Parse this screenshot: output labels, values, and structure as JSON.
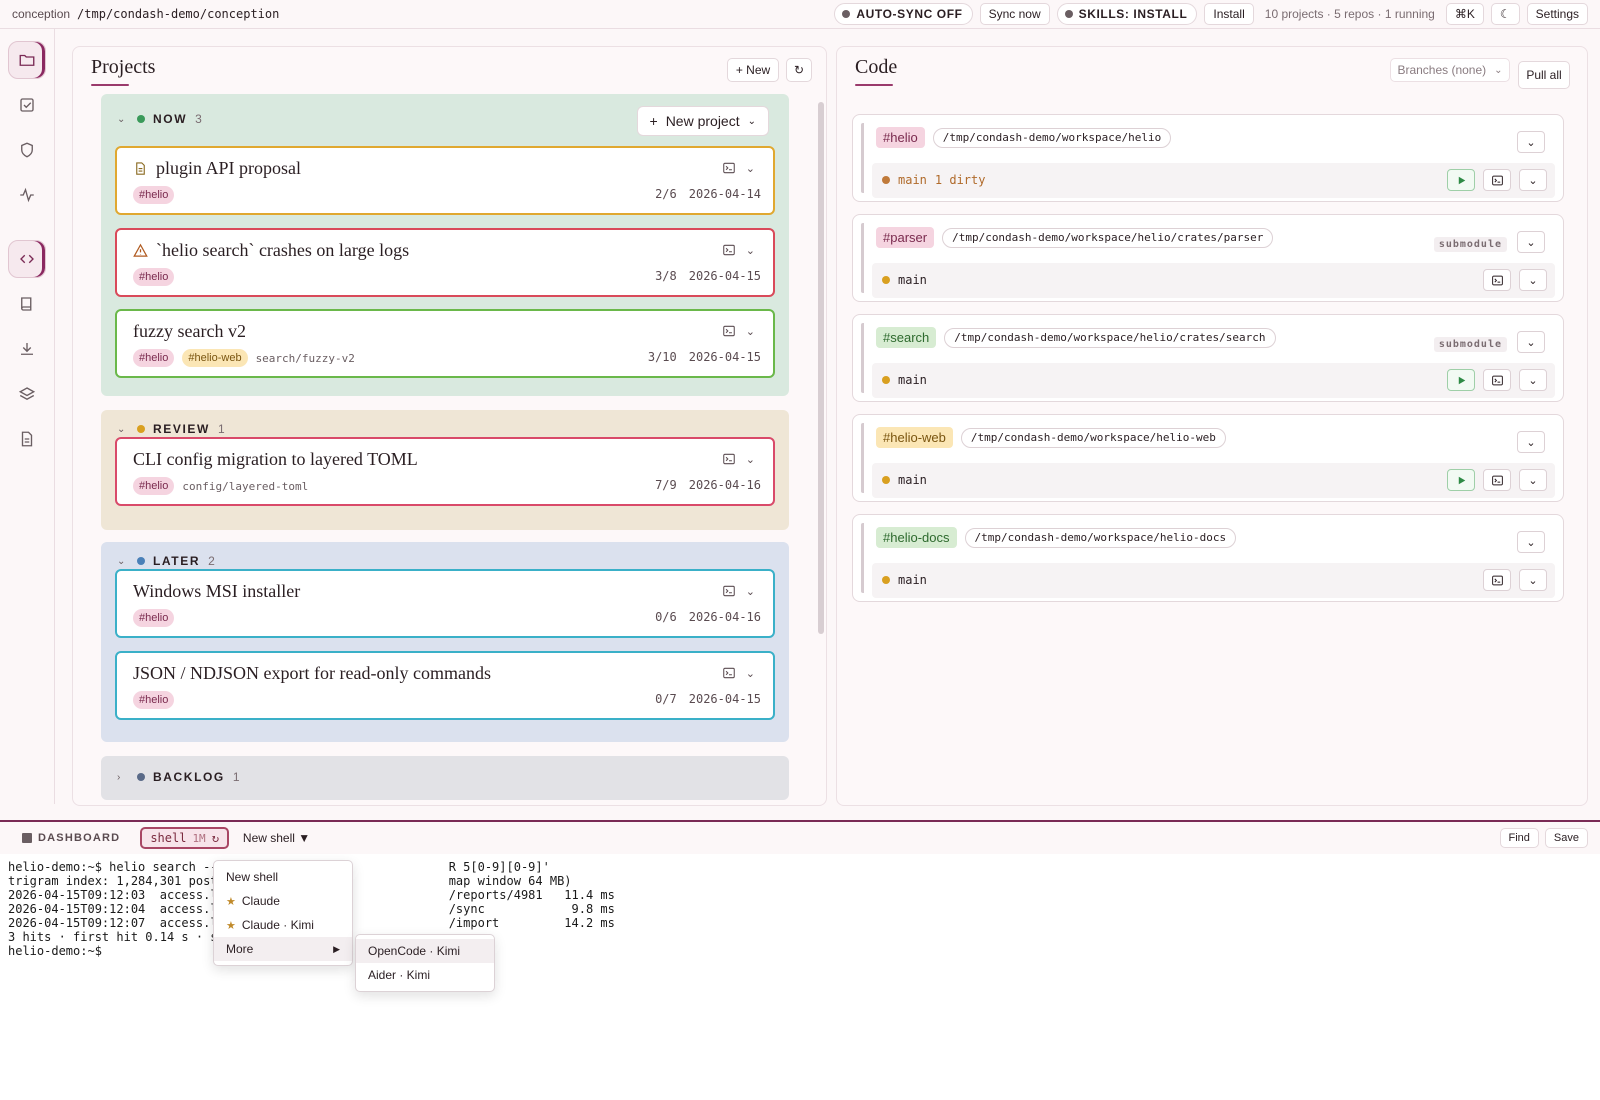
{
  "topbar": {
    "app": "conception",
    "path": "/tmp/condash-demo/conception",
    "autosync": "AUTO-SYNC OFF",
    "sync_now": "Sync now",
    "skills": "SKILLS: INSTALL",
    "install": "Install",
    "stats": "10 projects · 5 repos · 1 running",
    "shortcut": "⌘K",
    "theme": "☾",
    "settings": "Settings"
  },
  "projects": {
    "title": "Projects",
    "new_label": "+ New",
    "refresh": "↻",
    "new_project": "New project",
    "groups": [
      {
        "name": "NOW",
        "count": "3",
        "color": "#3a9a5a",
        "bg": "#d9e9df",
        "cards": [
          {
            "title": "plugin API proposal",
            "icon": "document-icon",
            "tags": [
              "#helio"
            ],
            "branch": "",
            "progress": "2/6",
            "date": "2026-04-14",
            "border": "#e0a830"
          },
          {
            "title": "`helio search` crashes on large logs",
            "icon": "warning-icon",
            "tags": [
              "#helio"
            ],
            "branch": "",
            "progress": "3/8",
            "date": "2026-04-15",
            "border": "#d94a5a"
          },
          {
            "title": "fuzzy search v2",
            "icon": "",
            "tags": [
              "#helio",
              "#helio-web"
            ],
            "branch": "search/fuzzy-v2",
            "progress": "3/10",
            "date": "2026-04-15",
            "border": "#6ab84a"
          }
        ]
      },
      {
        "name": "REVIEW",
        "count": "1",
        "color": "#d9a020",
        "bg": "#efe6d6",
        "cards": [
          {
            "title": "CLI config migration to layered TOML",
            "icon": "",
            "tags": [
              "#helio"
            ],
            "branch": "config/layered-toml",
            "progress": "7/9",
            "date": "2026-04-16",
            "border": "#d94a6a"
          }
        ]
      },
      {
        "name": "LATER",
        "count": "2",
        "color": "#4a80b8",
        "bg": "#dbe1ee",
        "cards": [
          {
            "title": "Windows MSI installer",
            "icon": "",
            "tags": [
              "#helio"
            ],
            "branch": "",
            "progress": "0/6",
            "date": "2026-04-16",
            "border": "#3ab0c8"
          },
          {
            "title": "JSON / NDJSON export for read-only commands",
            "icon": "",
            "tags": [
              "#helio"
            ],
            "branch": "",
            "progress": "0/7",
            "date": "2026-04-15",
            "border": "#3ab0c8"
          }
        ]
      },
      {
        "name": "BACKLOG",
        "count": "1",
        "color": "#5a6a88",
        "bg": "#e2e2e6",
        "cards": []
      }
    ]
  },
  "code": {
    "title": "Code",
    "branches": "Branches (none)",
    "pull_all": "Pull all",
    "repos": [
      {
        "tag": "#helio",
        "tag_bg": "#f5d4e0",
        "tag_fg": "#7a2a4e",
        "path": "/tmp/condash-demo/workspace/helio",
        "branch": "main",
        "dirty": "1 dirty",
        "submodule": "",
        "run": true
      },
      {
        "tag": "#parser",
        "tag_bg": "#f5d4e0",
        "tag_fg": "#7a2a4e",
        "path": "/tmp/condash-demo/workspace/helio/crates/parser",
        "branch": "main",
        "dirty": "",
        "submodule": "submodule",
        "run": false
      },
      {
        "tag": "#search",
        "tag_bg": "#d7ecd2",
        "tag_fg": "#2e6a2e",
        "path": "/tmp/condash-demo/workspace/helio/crates/search",
        "branch": "main",
        "dirty": "",
        "submodule": "submodule",
        "run": true
      },
      {
        "tag": "#helio-web",
        "tag_bg": "#fbe6b5",
        "tag_fg": "#7a5510",
        "path": "/tmp/condash-demo/workspace/helio-web",
        "branch": "main",
        "dirty": "",
        "submodule": "",
        "run": true
      },
      {
        "tag": "#helio-docs",
        "tag_bg": "#d7ecd2",
        "tag_fg": "#2e6a2e",
        "path": "/tmp/condash-demo/workspace/helio-docs",
        "branch": "main",
        "dirty": "",
        "submodule": "",
        "run": false
      }
    ]
  },
  "terminal": {
    "dashboard": "DASHBOARD",
    "shell_tab": "shell",
    "shell_time": "1M",
    "new_shell": "New shell ▼",
    "find": "Find",
    "save": "Save",
    "lines": [
      "helio-demo:~$ helio search --                                R 5[0-9][0-9]'",
      "trigram index: 1,284,301 post                                map window 64 MB)",
      "2026-04-15T09:12:03  access.l                                /reports/4981   11.4 ms",
      "2026-04-15T09:12:04  access.l                                /sync            9.8 ms",
      "2026-04-15T09:12:07  access.l                                /import         14.2 ms",
      "3 hits · first hit 0.14 s · s",
      "helio-demo:~$"
    ],
    "menu": [
      "New shell",
      "Claude",
      "Claude · Kimi",
      "More"
    ],
    "submenu": [
      "OpenCode · Kimi",
      "Aider · Kimi"
    ]
  }
}
